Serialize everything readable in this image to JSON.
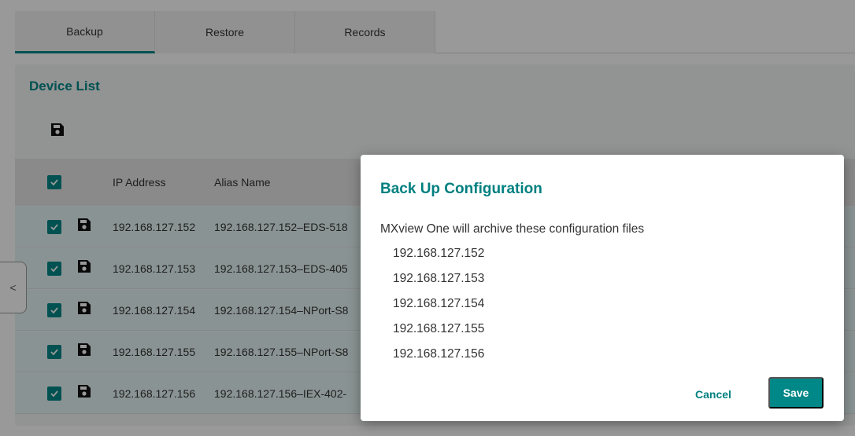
{
  "tabs": [
    {
      "label": "Backup"
    },
    {
      "label": "Restore"
    },
    {
      "label": "Records"
    }
  ],
  "card": {
    "title": "Device List"
  },
  "table": {
    "headers": {
      "ip": "IP Address",
      "alias": "Alias Name"
    },
    "rows": [
      {
        "ip": "192.168.127.152",
        "alias": "192.168.127.152–EDS-518"
      },
      {
        "ip": "192.168.127.153",
        "alias": "192.168.127.153–EDS-405"
      },
      {
        "ip": "192.168.127.154",
        "alias": "192.168.127.154–NPort-S8"
      },
      {
        "ip": "192.168.127.155",
        "alias": "192.168.127.155–NPort-S8"
      },
      {
        "ip": "192.168.127.156",
        "alias": "192.168.127.156–IEX-402-"
      }
    ]
  },
  "sidebar_toggle": {
    "glyph": "<"
  },
  "dialog": {
    "title": "Back Up Configuration",
    "message": "MXview One will archive these configuration files",
    "files": [
      "192.168.127.152",
      "192.168.127.153",
      "192.168.127.154",
      "192.168.127.155",
      "192.168.127.156"
    ],
    "cancel_label": "Cancel",
    "save_label": "Save"
  },
  "colors": {
    "accent": "#008787",
    "row_selected": "#e7f6f6"
  },
  "icons": {
    "save": "floppy-disk-icon",
    "check": "checkbox-checked-icon",
    "collapse": "chevron-left-icon"
  }
}
